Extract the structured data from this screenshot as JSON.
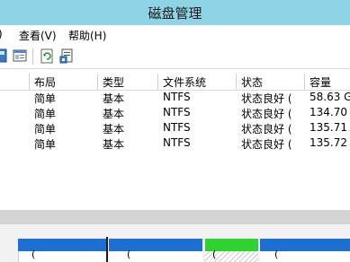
{
  "window": {
    "title": "磁盘管理"
  },
  "menu": {
    "partial_left": ")",
    "view": "查看(V)",
    "help": "帮助(H)"
  },
  "toolbar": {
    "icons": [
      "console-icon",
      "properties-icon",
      "refresh-icon",
      "help-icon"
    ]
  },
  "table": {
    "columns": [
      "布局",
      "类型",
      "文件系统",
      "状态",
      "容量"
    ],
    "rows": [
      {
        "layout": "简单",
        "type": "基本",
        "fs": "NTFS",
        "status": "状态良好 (",
        "capacity": "58.63 G"
      },
      {
        "layout": "简单",
        "type": "基本",
        "fs": "NTFS",
        "status": "状态良好 (",
        "capacity": "134.70 ("
      },
      {
        "layout": "简单",
        "type": "基本",
        "fs": "NTFS",
        "status": "状态良好 (",
        "capacity": "135.71 ("
      },
      {
        "layout": "简单",
        "type": "基本",
        "fs": "NTFS",
        "status": "状态良好 (",
        "capacity": "135.72 ("
      }
    ]
  },
  "lower_pane": {
    "volume_labels": [
      "(",
      "(",
      "(",
      "("
    ]
  },
  "colors": {
    "titlebar": "#8ed3e6",
    "disk_primary": "#1e6fd4",
    "disk_free": "#2fd32f",
    "selection_border": "#1b1b1b"
  }
}
